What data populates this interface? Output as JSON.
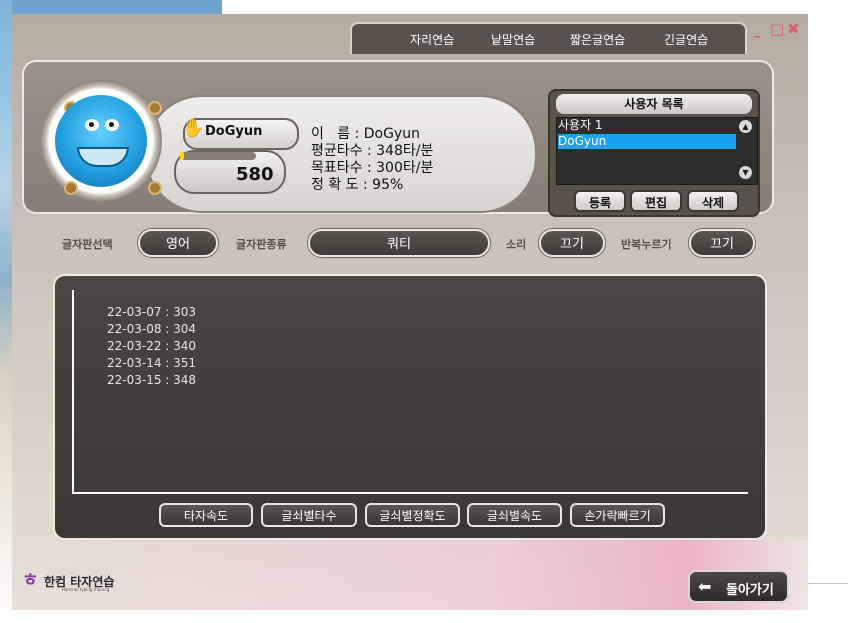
{
  "window_controls": {
    "help": "?",
    "minimize": "_",
    "maximize": "□",
    "close": "✖"
  },
  "tabs": [
    {
      "label": "자리연습"
    },
    {
      "label": "낱말연습"
    },
    {
      "label": "짧은글연습"
    },
    {
      "label": "긴글연습"
    }
  ],
  "profile": {
    "name": "DoGyun",
    "score": "580",
    "progress_fraction": 0.05,
    "stats": [
      "이   름 : DoGyun",
      "평균타수 : 348타/분",
      "목표타수 : 300타/분",
      "정 확 도 : 95%"
    ]
  },
  "user_list": {
    "title": "사용자 목록",
    "items": [
      "사용자 1",
      "DoGyun"
    ],
    "selected": "DoGyun",
    "buttons": {
      "register": "등록",
      "edit": "편집",
      "delete": "삭제"
    }
  },
  "options": {
    "keyboard_select_label": "글자판선택",
    "keyboard_select_value": "영어",
    "keyboard_type_label": "글자판종류",
    "keyboard_type_value": "쿼티",
    "sound_label": "소리",
    "sound_value": "끄기",
    "repeat_label": "반복누르기",
    "repeat_value": "끄기"
  },
  "records": [
    "22-03-07 : 303",
    "22-03-08 : 304",
    "22-03-22 : 340",
    "22-03-14 : 351",
    "22-03-15 : 348"
  ],
  "graph_buttons": [
    "타자속도",
    "글쇠별타수",
    "글쇠별정확도",
    "글쇠별속도",
    "손가락빠르기"
  ],
  "footer": {
    "logo_text": "한컴 타자연습",
    "logo_sub": "Hancom typing training",
    "back_label": "돌아가기"
  }
}
